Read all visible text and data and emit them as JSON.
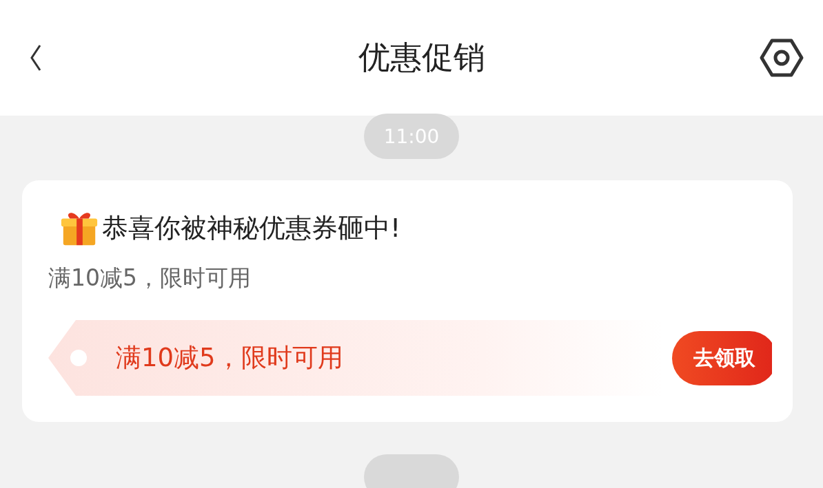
{
  "header": {
    "title": "优惠促销"
  },
  "messages": [
    {
      "time": "11:00",
      "card": {
        "title": "恭喜你被神秘优惠券砸中!",
        "subtitle": "满10减5，限时可用",
        "coupon": {
          "text": "满10减5，限时可用",
          "button": "去领取"
        }
      }
    }
  ]
}
